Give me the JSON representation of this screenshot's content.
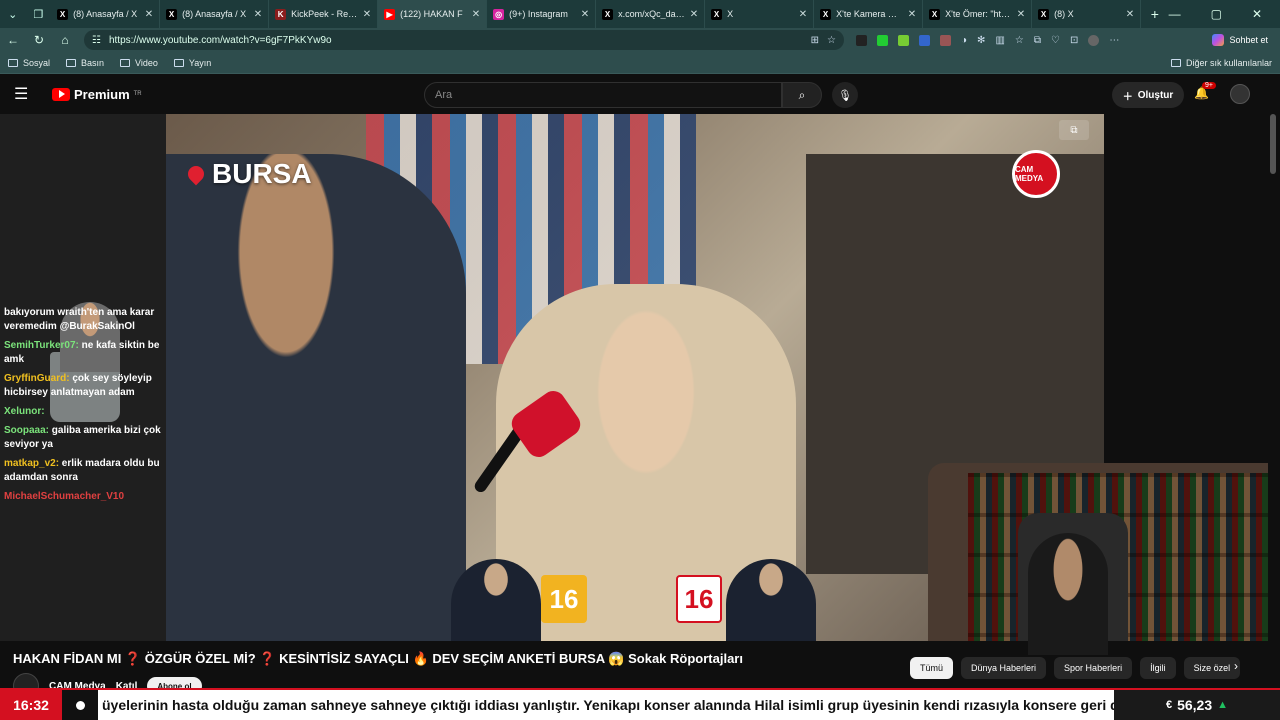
{
  "browser": {
    "tabs": [
      {
        "label": "(8) Anasayfa / X",
        "icon": "x-icon",
        "color": "#000000",
        "glyph": "X"
      },
      {
        "label": "(8) Anasayfa / X",
        "icon": "x-icon",
        "color": "#000000",
        "glyph": "X"
      },
      {
        "label": "KickPeek - Real-time",
        "icon": "kickpeek-icon",
        "color": "#8a1d1d",
        "glyph": "K"
      },
      {
        "label": "(122) HAKAN F",
        "icon": "youtube-icon",
        "color": "#ff0000",
        "glyph": "▶",
        "active": true
      },
      {
        "label": "(9+) Instagram",
        "icon": "instagram-icon",
        "color": "#d6249f",
        "glyph": "◎"
      },
      {
        "label": "x.com/xQc_dailyy/st",
        "icon": "x-icon",
        "color": "#000000",
        "glyph": "X"
      },
      {
        "label": "X",
        "icon": "x-icon",
        "color": "#000000",
        "glyph": "X"
      },
      {
        "label": "X'te Kamera Kaydı",
        "icon": "x-icon",
        "color": "#000000",
        "glyph": "X"
      },
      {
        "label": "X'te Ömer: \"https://",
        "icon": "x-icon",
        "color": "#000000",
        "glyph": "X"
      },
      {
        "label": "(8) X",
        "icon": "x-icon",
        "color": "#000000",
        "glyph": "X"
      }
    ],
    "url": "https://www.youtube.com/watch?v=6gF7PkKYw9o",
    "sohbet_label": "Sohbet et",
    "bookmarks": [
      "Sosyal",
      "Basın",
      "Video",
      "Yayın"
    ],
    "other_bookmarks": "Diğer sık kullanılanlar"
  },
  "youtube": {
    "logo_text": "Premium",
    "logo_region": "TR",
    "search_placeholder": "Ara",
    "create_label": "Oluştur",
    "notif_count": "9+"
  },
  "video": {
    "location": "BURSA",
    "logo_text": "CAM MEDYA",
    "num_left": "16",
    "num_right": "16"
  },
  "chat": [
    {
      "user": "",
      "text": "bakıyorum wraith'ten ama karar veremedim @BurakSakinOl",
      "color": "g"
    },
    {
      "user": "SemihTurker07:",
      "text": " ne kafa siktin be amk",
      "color": "g"
    },
    {
      "user": "GryffinGuard:",
      "text": " çok sey söyleyip hicbirsey anlatmayan adam",
      "color": "y"
    },
    {
      "user": "Xelunor:",
      "text": " ",
      "color": "g"
    },
    {
      "user": "Soopaaa:",
      "text": " galiba amerika bizi çok seviyor ya",
      "color": "g"
    },
    {
      "user": "matkap_v2:",
      "text": " erlik madara oldu bu adamdan sonra",
      "color": "y"
    },
    {
      "user": "MichaelSchumacher_V10",
      "text": "",
      "color": "r"
    }
  ],
  "below": {
    "title": "HAKAN FİDAN MI ❓ ÖZGÜR ÖZEL Mİ? ❓ KESİNTİSİZ SAYAÇLI 🔥 DEV SEÇİM ANKETİ BURSA 😱 Sokak Röportajları",
    "channel": "CAM Medya",
    "join": "Katıl",
    "subscribe": "Abone ol",
    "chips": [
      "Tümü",
      "Dünya Haberleri",
      "Spor Haberleri",
      "İlgili",
      "Size özel"
    ]
  },
  "ticker": {
    "time": "16:32",
    "text": "üyelerinin hasta olduğu zaman sahneye sahneye çıktığı iddiası yanlıştır. Yenikapı konser alanında Hilal isimli grup üyesinin kendi rızasıyla konsere geri dönme",
    "currency_symbol": "€",
    "currency_value": "56,23"
  }
}
